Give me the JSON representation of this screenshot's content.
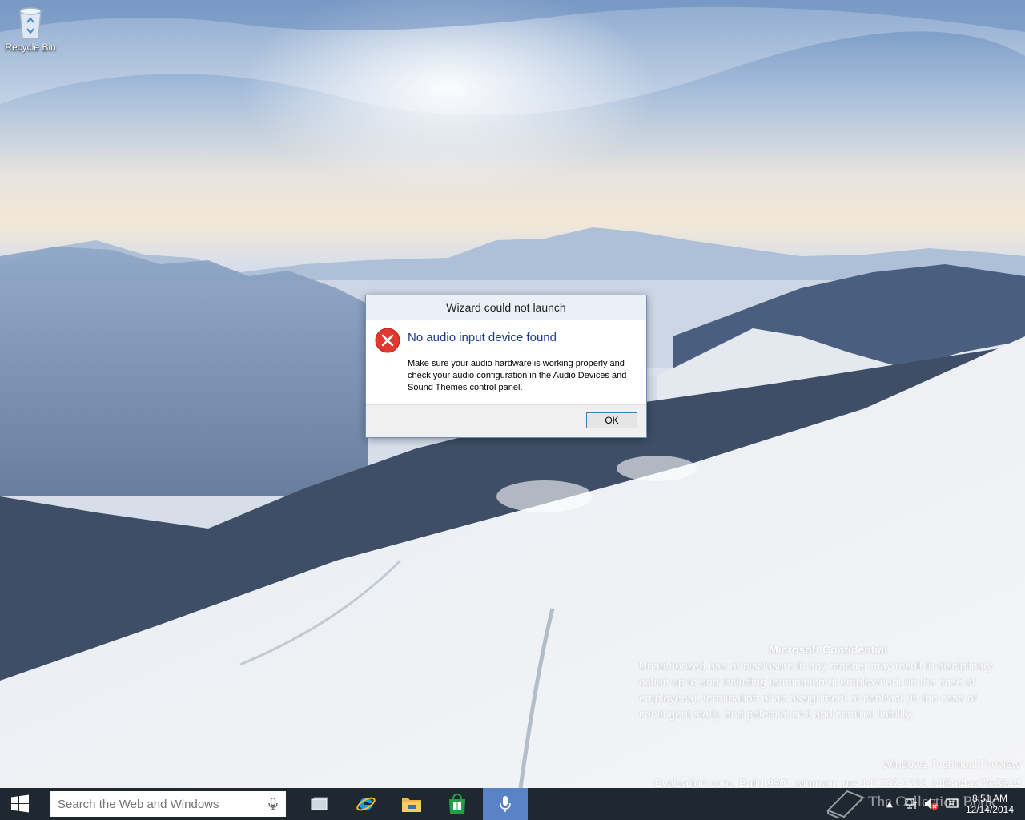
{
  "desktop": {
    "icons": [
      {
        "label": "Recycle Bin",
        "icon": "recycle-bin-icon"
      }
    ]
  },
  "dialog": {
    "title": "Wizard could not launch",
    "icon": "error-icon",
    "heading": "No audio input device found",
    "message": "Make sure your audio hardware is working properly and check your audio configuration in the Audio Devices and Sound Themes control panel.",
    "ok_label": "OK"
  },
  "watermark": {
    "title": "Microsoft Confidential",
    "text": "Unauthorized use or disclosure in any manner may result in disciplinary action up to and including termination of employment (in the case of employees), termination of an assignment or contract (in the case of contingent staff), and potential civil and criminal liability."
  },
  "build": {
    "product": "Windows Technical Preview",
    "evaluation": "Evaluation copy. Build 9901.winmain_prs.141202-1718.c4f9af4aa7fe8544"
  },
  "taskbar": {
    "search_placeholder": "Search the Web and Windows",
    "pinned": [
      "task-view-icon",
      "internet-explorer-icon",
      "file-explorer-icon",
      "store-icon",
      "microphone-icon"
    ],
    "tray": {
      "chevron": "▲",
      "icons": [
        "network-icon",
        "volume-muted-icon",
        "action-center-icon"
      ]
    },
    "clock": {
      "time": "8:51 AM",
      "date": "12/14/2014"
    }
  },
  "overlay_logo": "The Collection Book",
  "colors": {
    "taskbar": "#1f2731",
    "active_button": "#5a82c6",
    "error_red": "#e0372f",
    "dialog_heading": "#1a3a8f"
  }
}
